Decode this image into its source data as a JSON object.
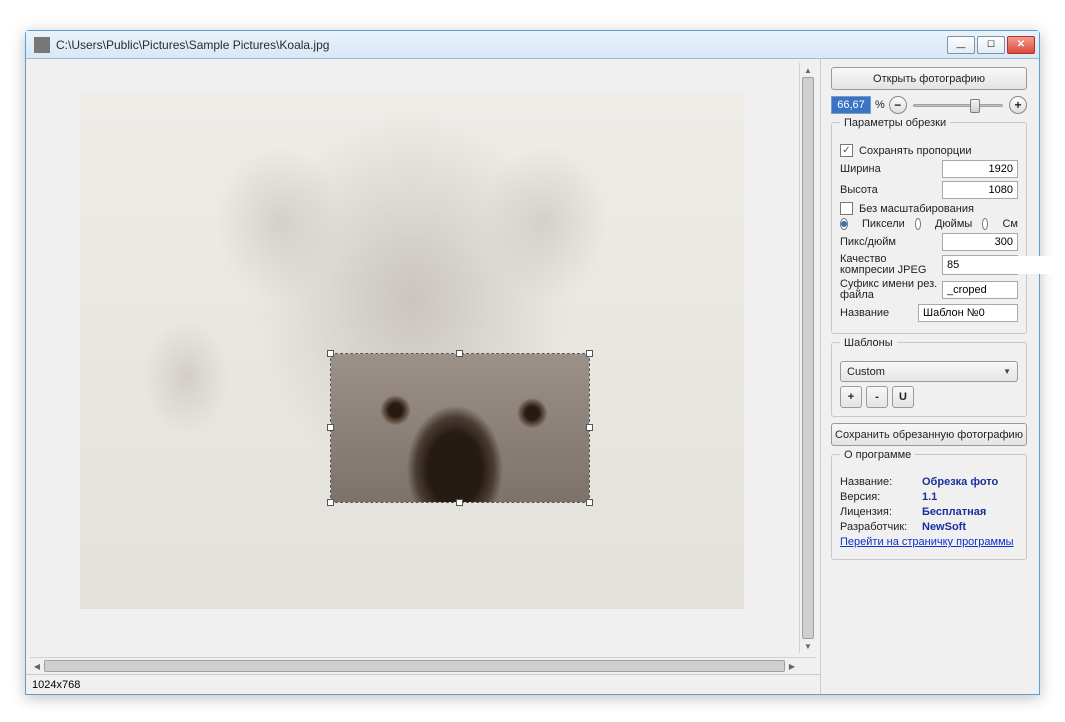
{
  "window": {
    "title": "C:\\Users\\Public\\Pictures\\Sample Pictures\\Koala.jpg"
  },
  "status": {
    "dims": "1024x768"
  },
  "actions": {
    "open": "Открыть фотографию",
    "save": "Сохранить обрезанную фотографию"
  },
  "zoom": {
    "value": "66,67",
    "percent_symbol": "%",
    "minus": "−",
    "plus": "+"
  },
  "crop_params": {
    "title": "Параметры обрезки",
    "keep_ratio_label": "Сохранять пропорции",
    "keep_ratio_checked": "✓",
    "width_label": "Ширина",
    "width": "1920",
    "height_label": "Высота",
    "height": "1080",
    "no_scale_label": "Без масштабирования",
    "units_px": "Пиксели",
    "units_in": "Дюймы",
    "units_cm": "См",
    "dpi_label": "Пикс/дюйм",
    "dpi": "300",
    "jpeg_label": "Качество компресии JPEG",
    "jpeg": "85",
    "suffix_label": "Суфикс имени рез. файла",
    "suffix": "_croped",
    "name_label": "Название",
    "name": "Шаблон №0"
  },
  "templates": {
    "title": "Шаблоны",
    "current": "Custom",
    "add": "+",
    "remove": "-",
    "update": "U"
  },
  "about": {
    "title": "О программе",
    "name_label": "Название:",
    "name": "Обрезка фото",
    "version_label": "Версия:",
    "version": "1.1",
    "license_label": "Лицензия:",
    "license": "Бесплатная",
    "dev_label": "Разработчик:",
    "dev": "NewSoft",
    "link": "Перейти на страничку программы"
  }
}
